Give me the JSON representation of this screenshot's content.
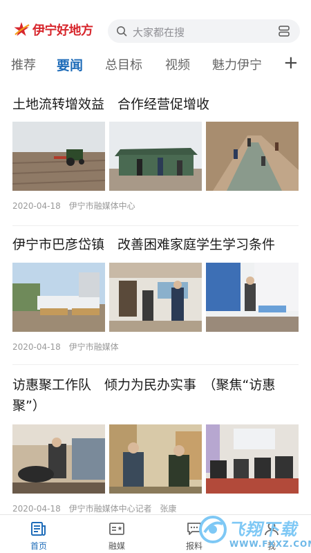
{
  "app": {
    "logo_text": "伊宁好地方",
    "search_placeholder": "大家都在搜"
  },
  "tabs": [
    {
      "label": "推荐",
      "active": false
    },
    {
      "label": "要闻",
      "active": true
    },
    {
      "label": "总目标",
      "active": false
    },
    {
      "label": "视频",
      "active": false
    },
    {
      "label": "魅力伊宁",
      "active": false
    }
  ],
  "tab_more": "+",
  "articles": [
    {
      "title": "土地流转增效益　合作经营促增收",
      "date": "2020-04-18",
      "source": "伊宁市融媒体中心",
      "thumbnails": [
        "tractor-field-photo",
        "greenhouse-workers-photo",
        "irrigation-ditch-photo"
      ]
    },
    {
      "title": "伊宁市巴彦岱镇　改善困难家庭学生学习条件",
      "date": "2020-04-18",
      "source": "伊宁市融媒体",
      "thumbnails": [
        "courtyard-desks-photo",
        "home-doorway-visit-photo",
        "student-study-room-photo"
      ]
    },
    {
      "title": "访惠聚工作队　倾力为民办实事　（聚焦“访惠聚”）",
      "date": "2020-04-18",
      "source": "伊宁市融媒体中心记者",
      "author": "张康",
      "thumbnails": [
        "stove-kitchen-photo",
        "shop-visit-photo",
        "family-room-photo"
      ]
    }
  ],
  "bottom_nav": [
    {
      "label": "首页",
      "icon": "home-news-icon",
      "active": true
    },
    {
      "label": "融媒",
      "icon": "media-card-icon",
      "active": false
    },
    {
      "label": "报料",
      "icon": "report-chat-icon",
      "active": false
    },
    {
      "label": "我",
      "icon": "profile-icon",
      "active": false
    }
  ],
  "watermark": {
    "text": "飞翔下载",
    "url": "WWW.FXXZ.COM"
  },
  "colors": {
    "brand_red": "#d7262c",
    "accent_blue": "#1d6bb8"
  }
}
